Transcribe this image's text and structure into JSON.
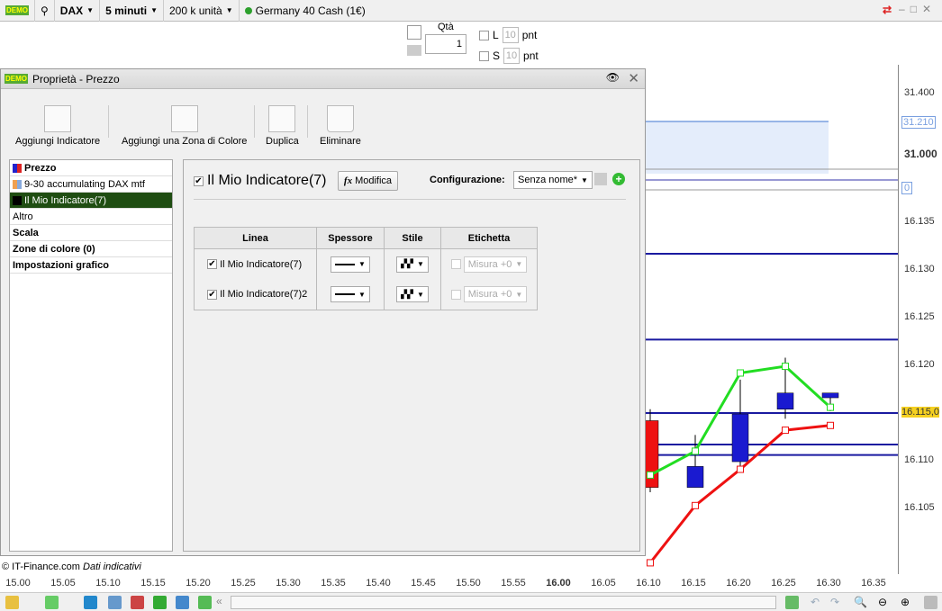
{
  "topbar": {
    "logo": "DEMO",
    "instrument": "DAX",
    "timeframe": "5 minuti",
    "units": "200 k unità",
    "market_status_color": "#2ca02c",
    "market": "Germany 40 Cash (1€)"
  },
  "order": {
    "qty_label": "Qtà",
    "qty": "1",
    "long_label": "L",
    "short_label": "S",
    "long_pts": "10",
    "short_pts": "10",
    "pnt": "pnt"
  },
  "dialog": {
    "title": "Proprietà - Prezzo",
    "toolbar": [
      {
        "label": "Aggiungi Indicatore",
        "icon": "add-indicator-icon"
      },
      {
        "label": "Aggiungi una Zona di Colore",
        "icon": "add-color-zone-icon"
      },
      {
        "label": "Duplica",
        "icon": "duplicate-icon"
      },
      {
        "label": "Eliminare",
        "icon": "trash-icon"
      }
    ],
    "tree": [
      {
        "label": "Prezzo",
        "bold": true,
        "color": "#d0021b"
      },
      {
        "label": "9-30 accumulating DAX mtf",
        "color": "#f0a050"
      },
      {
        "label": "Il Mio Indicatore(7)",
        "selected": true,
        "color": "#000000"
      },
      {
        "label": "Altro"
      },
      {
        "label": "Scala",
        "bold": true
      },
      {
        "label": "Zone di colore (0)",
        "bold": true
      },
      {
        "label": "Impostazioni grafico",
        "bold": true
      }
    ],
    "indicator": {
      "name": "Il Mio Indicatore(7)",
      "checked": true,
      "edit_label": "Modifica",
      "config_label": "Configurazione:",
      "config_value": "Senza nome*"
    },
    "table": {
      "headers": [
        "Linea",
        "Spessore",
        "Stile",
        "Etichetta"
      ],
      "rows": [
        {
          "name": "Il Mio Indicatore(7)",
          "checked": true,
          "label_checked": false,
          "label_value": "Misura +0"
        },
        {
          "name": "Il Mio Indicatore(7)2",
          "checked": true,
          "label_checked": false,
          "label_value": "Misura +0"
        }
      ]
    }
  },
  "chart_data": {
    "type": "candlestick",
    "x": [
      "16.10",
      "16.15",
      "16.20",
      "16.25",
      "16.30"
    ],
    "ohlc": [
      [
        16.1142,
        16.1154,
        16.1067,
        16.1072
      ],
      [
        16.1072,
        16.1127,
        16.1072,
        16.1094
      ],
      [
        16.1099,
        16.1185,
        16.109,
        16.1149
      ],
      [
        16.1154,
        16.1208,
        16.1144,
        16.1171
      ],
      [
        16.1166,
        16.1171,
        16.1152,
        16.1171
      ]
    ],
    "candle_colors": {
      "up": "#1a1ad0",
      "down": "#ee1111"
    },
    "series": [
      {
        "color": "#22dd22",
        "values": [
          16.1085,
          16.111,
          16.1192,
          16.1199,
          16.1156
        ]
      },
      {
        "color": "#ee1111",
        "values": [
          16.0993,
          16.1053,
          16.1091,
          16.1132,
          16.1137
        ]
      }
    ],
    "hlines": [
      16.1317,
      16.1227,
      16.115,
      16.1117,
      16.1106
    ],
    "ylim": [
      16.1,
      16.138
    ],
    "yticks": [
      "16.135",
      "16.130",
      "16.125",
      "16.120",
      "16.115,0",
      "16.110",
      "16.105"
    ],
    "upper_panel": {
      "yticks": [
        "31.400",
        "31.210",
        "31.000"
      ],
      "zone_top": 31.21,
      "secondary_label": "0"
    },
    "xticks": [
      "15.00",
      "15.05",
      "15.10",
      "15.15",
      "15.20",
      "15.25",
      "15.30",
      "15.35",
      "15.40",
      "15.45",
      "15.50",
      "15.55",
      "16.00",
      "16.05",
      "16.10",
      "16.15",
      "16.20",
      "16.25",
      "16.30",
      "16.35"
    ],
    "current_price": "16.115,0"
  },
  "footer": {
    "copyright": "© IT-Finance.com",
    "note": "Dati indicativi"
  }
}
